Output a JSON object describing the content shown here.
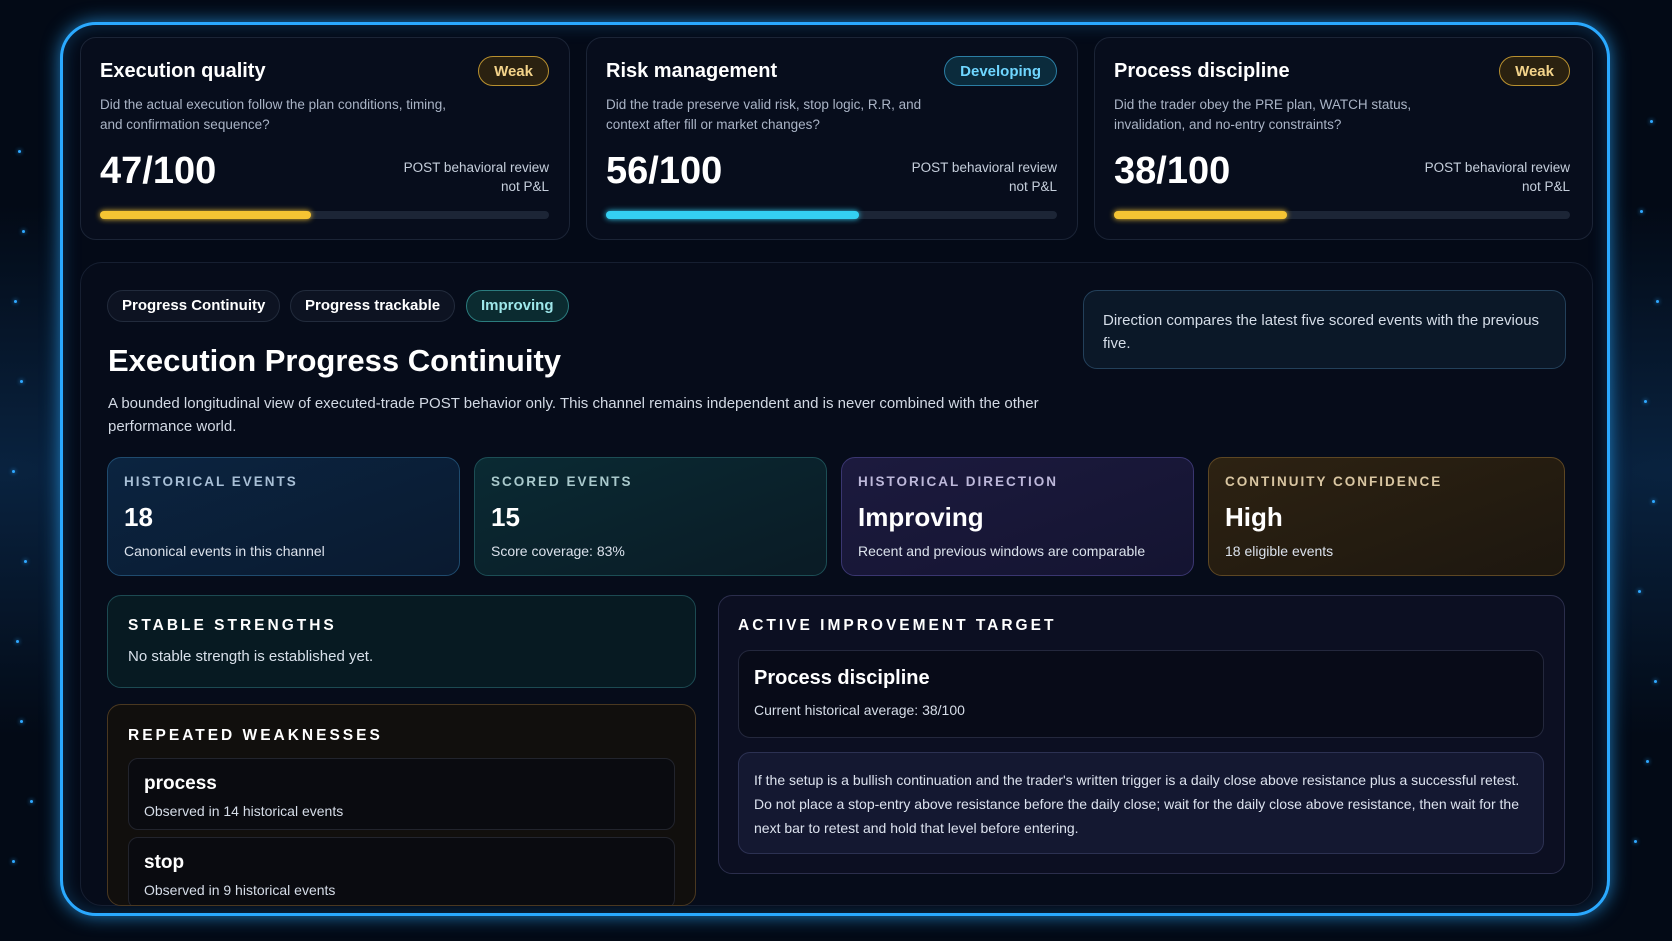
{
  "colors": {
    "accent": "#2aa9ff",
    "weak": "#f5c433",
    "developing": "#34d0f2"
  },
  "cards": [
    {
      "title": "Execution quality",
      "badge": "Weak",
      "badge_type": "weak",
      "description": "Did the actual execution follow the plan conditions, timing, and confirmation sequence?",
      "score": "47/100",
      "score_value": 47,
      "note_line1": "POST behavioral review",
      "note_line2": "not P&L",
      "bar_color": "#f5c433"
    },
    {
      "title": "Risk management",
      "badge": "Developing",
      "badge_type": "dev",
      "description": "Did the trade preserve valid risk, stop logic, R.R, and context after fill or market changes?",
      "score": "56/100",
      "score_value": 56,
      "note_line1": "POST behavioral review",
      "note_line2": "not P&L",
      "bar_color": "#34d0f2"
    },
    {
      "title": "Process discipline",
      "badge": "Weak",
      "badge_type": "weak",
      "description": "Did the trader obey the PRE plan, WATCH status, invalidation, and no-entry constraints?",
      "score": "38/100",
      "score_value": 38,
      "note_line1": "POST behavioral review",
      "note_line2": "not P&L",
      "bar_color": "#f5c433"
    }
  ],
  "pills": [
    "Progress Continuity",
    "Progress trackable",
    "Improving"
  ],
  "section": {
    "title": "Execution Progress Continuity",
    "subtitle": "A bounded longitudinal view of executed-trade POST behavior only. This channel remains independent and is never combined with the other performance world.",
    "info": "Direction compares the latest five scored events with the previous five."
  },
  "stats": [
    {
      "label": "HISTORICAL EVENTS",
      "value": "18",
      "sub": "Canonical events in this channel"
    },
    {
      "label": "SCORED EVENTS",
      "value": "15",
      "sub": "Score coverage: 83%"
    },
    {
      "label": "HISTORICAL DIRECTION",
      "value": "Improving",
      "sub": "Recent and previous windows are comparable"
    },
    {
      "label": "CONTINUITY CONFIDENCE",
      "value": "High",
      "sub": "18 eligible events"
    }
  ],
  "strengths": {
    "title": "STABLE STRENGTHS",
    "text": "No stable strength is established yet."
  },
  "weaknesses": {
    "title": "REPEATED WEAKNESSES",
    "items": [
      {
        "name": "process",
        "observed": "Observed in 14 historical events"
      },
      {
        "name": "stop",
        "observed": "Observed in 9 historical events"
      }
    ]
  },
  "target": {
    "title": "ACTIVE IMPROVEMENT TARGET",
    "name": "Process discipline",
    "average": "Current historical average: 38/100",
    "text": "If the setup is a bullish continuation and the trader's written trigger is a daily close above resistance plus a successful retest. Do not place a stop-entry above resistance before the daily close; wait for the daily close above resistance, then wait for the next bar to retest and hold that level before entering."
  }
}
